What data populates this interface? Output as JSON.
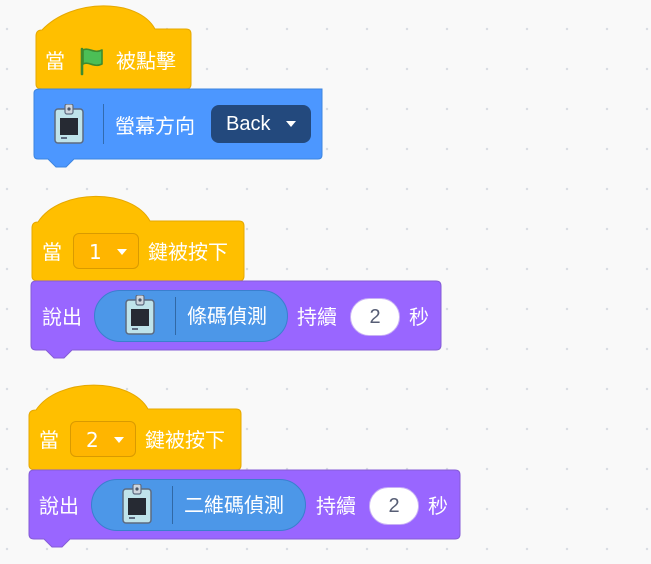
{
  "workspace": {
    "script1": {
      "hat_when": "當",
      "hat_clicked": "被點擊",
      "flag_icon": "green-flag-icon",
      "orientation_label": "螢幕方向",
      "orientation_value": "Back"
    },
    "script2": {
      "hat_when": "當",
      "key_value": "1",
      "hat_pressed": "鍵被按下",
      "say": "說出",
      "reporter_label": "條碼偵測",
      "for_label": "持續",
      "seconds_value": "2",
      "seconds_unit": "秒"
    },
    "script3": {
      "hat_when": "當",
      "key_value": "2",
      "hat_pressed": "鍵被按下",
      "say": "說出",
      "reporter_label": "二維碼偵測",
      "for_label": "持續",
      "seconds_value": "2",
      "seconds_unit": "秒"
    }
  },
  "colors": {
    "events": "#ffbf00",
    "extension": "#4c97ff",
    "looks": "#9966ff",
    "dropdown_dark": "#23497d"
  }
}
